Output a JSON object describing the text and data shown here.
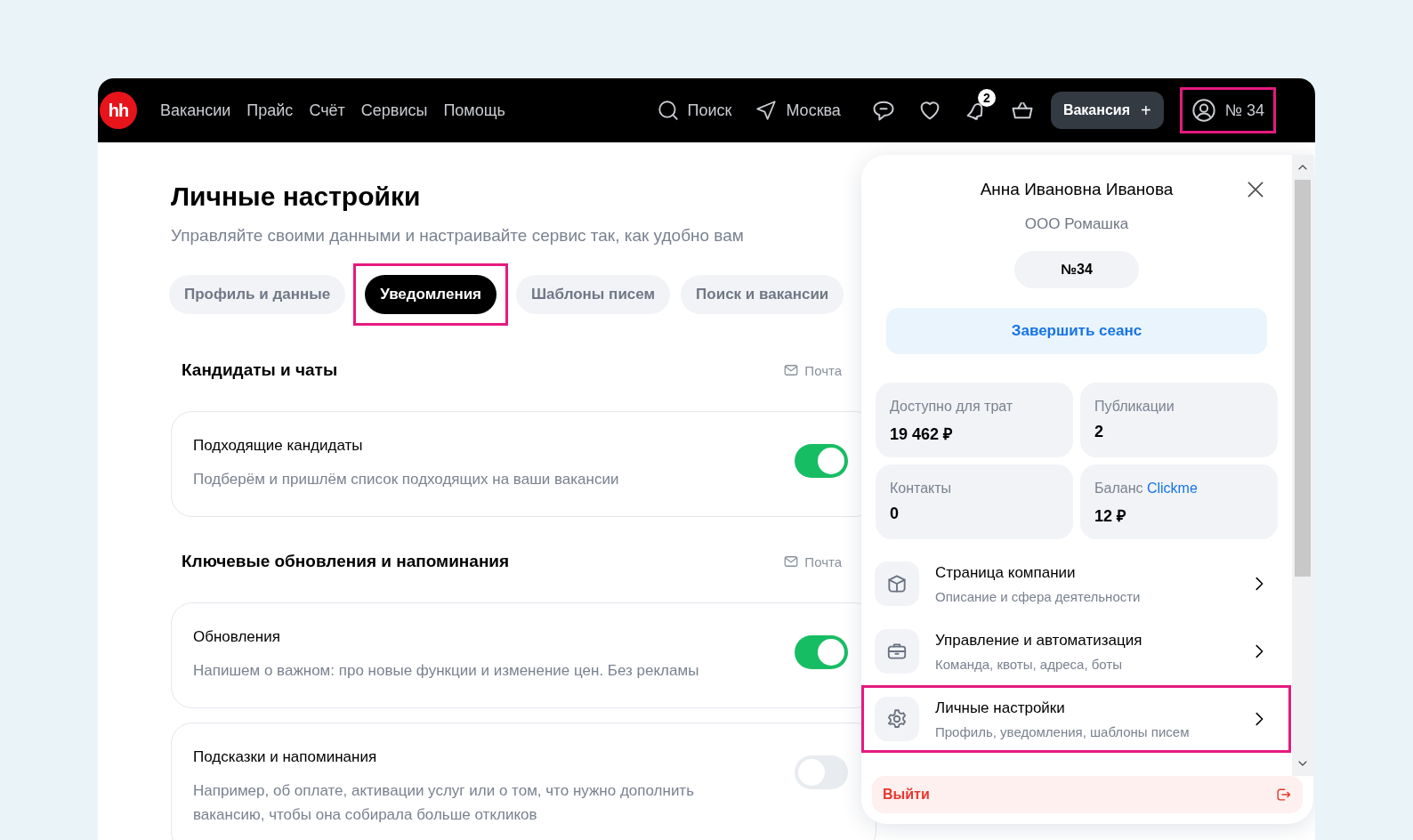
{
  "header": {
    "logo": "hh",
    "nav": [
      "Вакансии",
      "Прайс",
      "Счёт",
      "Сервисы",
      "Помощь"
    ],
    "search": "Поиск",
    "city": "Москва",
    "notifications_badge": "2",
    "vacancy_button": "Вакансия",
    "vacancy_plus": "+",
    "account": {
      "label": "№ 34",
      "highlighted": true
    }
  },
  "page": {
    "title": "Личные настройки",
    "subtitle": "Управляйте своими данными и настраивайте сервис так, как удобно вам",
    "tabs": [
      {
        "label": "Профиль и данные",
        "selected": false,
        "highlighted": false
      },
      {
        "label": "Уведомления",
        "selected": true,
        "highlighted": true
      },
      {
        "label": "Шаблоны писем",
        "selected": false,
        "highlighted": false
      },
      {
        "label": "Поиск и вакансии",
        "selected": false,
        "highlighted": false
      }
    ],
    "sections": [
      {
        "title": "Кандидаты и чаты",
        "channel": "Почта",
        "items": [
          {
            "title": "Подходящие кандидаты",
            "description": "Подберём и пришлём список подходящих на ваши вакансии",
            "on": true
          }
        ]
      },
      {
        "title": "Ключевые обновления и напоминания",
        "channel": "Почта",
        "items": [
          {
            "title": "Обновления",
            "description": "Напишем о важном: про новые функции и изменение цен. Без рекламы",
            "on": true
          },
          {
            "title": "Подсказки и напоминания",
            "description": "Например, об оплате, активации услуг или о том, что нужно дополнить вакансию, чтобы она собирала больше откликов",
            "on": false
          }
        ]
      }
    ]
  },
  "account_panel": {
    "name": "Анна Ивановна Иванова",
    "company": "ООО Ромашка",
    "id_chip": "№34",
    "end_session": "Завершить сеанс",
    "stats": [
      {
        "label": "Доступно для трат",
        "value": "19 462 ₽"
      },
      {
        "label": "Публикации",
        "value": "2"
      },
      {
        "label": "Контакты",
        "value": "0"
      },
      {
        "label": "Баланс",
        "link": "Clickme",
        "value": "12 ₽"
      }
    ],
    "menu": [
      {
        "kind": "company",
        "title": "Страница компании",
        "subtitle": "Описание и сфера деятельности",
        "highlighted": false
      },
      {
        "kind": "management",
        "title": "Управление и автоматизация",
        "subtitle": "Команда, квоты, адреса, боты",
        "highlighted": false
      },
      {
        "kind": "settings",
        "title": "Личные настройки",
        "subtitle": "Профиль, уведомления, шаблоны писем",
        "highlighted": true
      }
    ],
    "logout": "Выйти"
  }
}
